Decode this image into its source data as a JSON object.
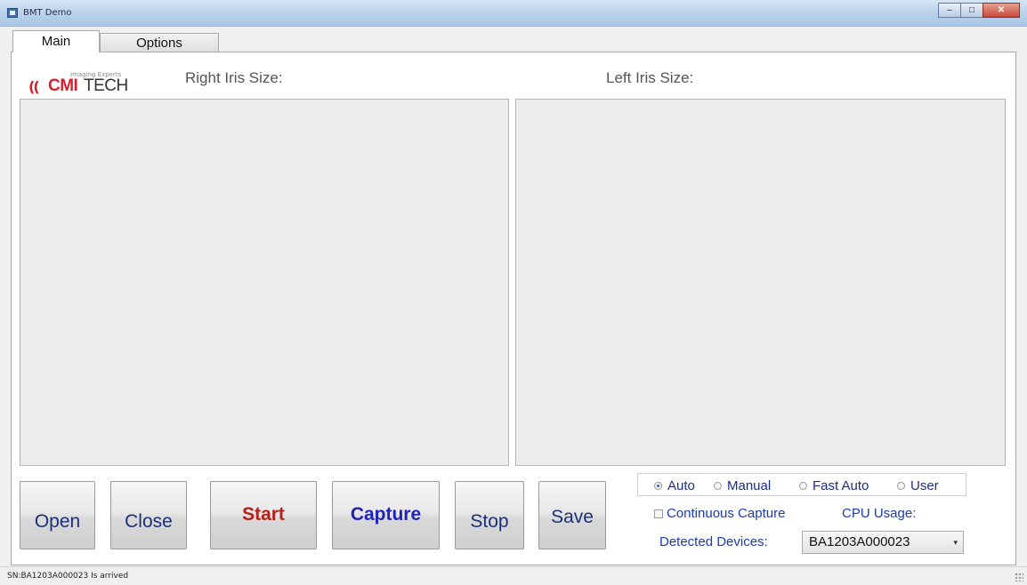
{
  "window": {
    "title": "BMT Demo"
  },
  "tabs": [
    {
      "label": "Main",
      "active": true
    },
    {
      "label": "Options",
      "active": false
    }
  ],
  "logo": {
    "tagline": "Imaging Experts",
    "mark": "((",
    "brand_bold": "CMI",
    "brand_rest": "TECH"
  },
  "labels": {
    "right_iris": "Right Iris Size:",
    "left_iris": "Left Iris Size:"
  },
  "buttons": {
    "open": "Open",
    "close": "Close",
    "start": "Start",
    "capture": "Capture",
    "stop": "Stop",
    "save": "Save"
  },
  "capture_mode": {
    "options": [
      "Auto",
      "Manual",
      "Fast Auto",
      "User"
    ],
    "selected": "Auto"
  },
  "continuous_capture": {
    "label": "Continuous Capture",
    "checked": false
  },
  "cpu_usage": {
    "label": "CPU Usage:"
  },
  "detected_devices": {
    "label": "Detected Devices:",
    "selected": "BA1203A000023"
  },
  "status": {
    "text": "SN:BA1203A000023 Is arrived"
  },
  "colors": {
    "accent_red": "#d4202f",
    "button_text_blue": "#1c2f7a",
    "start_red": "#b3201a",
    "capture_blue": "#1f23b8"
  }
}
